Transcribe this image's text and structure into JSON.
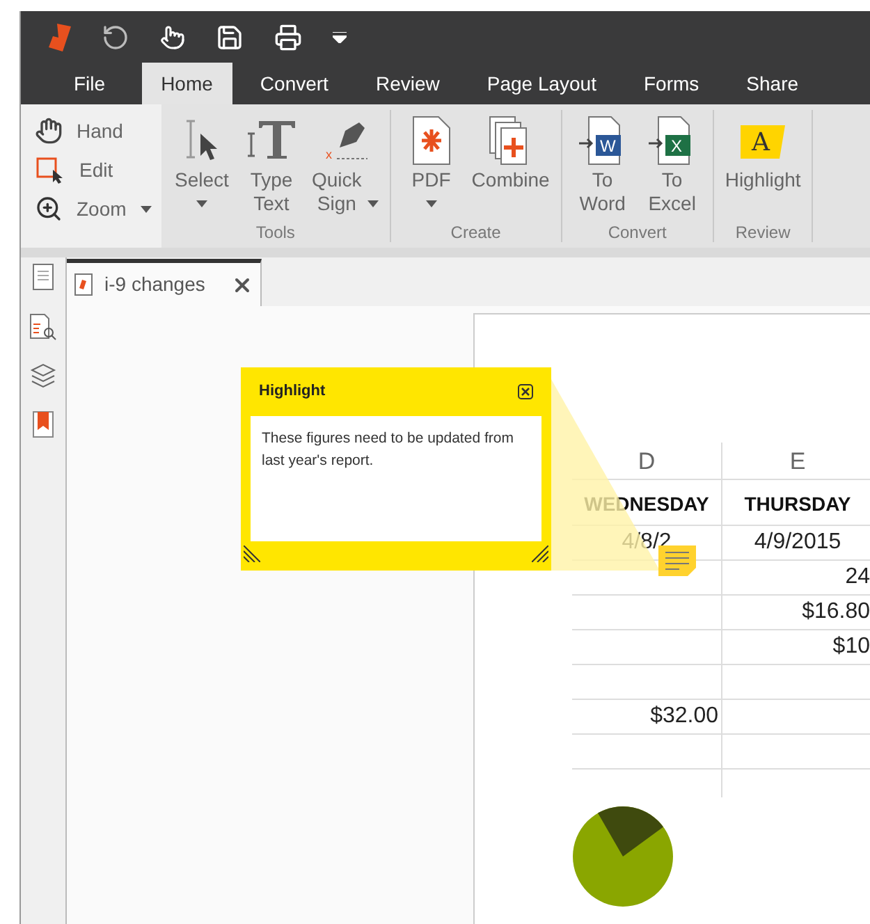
{
  "menu_tabs": [
    {
      "label": "File",
      "selected": false
    },
    {
      "label": "Home",
      "selected": true
    },
    {
      "label": "Convert",
      "selected": false
    },
    {
      "label": "Review",
      "selected": false
    },
    {
      "label": "Page Layout",
      "selected": false
    },
    {
      "label": "Forms",
      "selected": false
    },
    {
      "label": "Share",
      "selected": false
    }
  ],
  "nav_tools": [
    {
      "label": "Hand",
      "dropdown": false
    },
    {
      "label": "Edit",
      "dropdown": false
    },
    {
      "label": "Zoom",
      "dropdown": true
    }
  ],
  "ribbon_groups": [
    {
      "label": "Tools",
      "buttons": [
        {
          "label": "Select",
          "dropdown": true,
          "kind": "stacked"
        },
        {
          "label": "Type Text",
          "dropdown": false,
          "kind": "stacked"
        },
        {
          "label": "Quick Sign",
          "dropdown": true,
          "kind": "inline",
          "icon_text": "x"
        }
      ]
    },
    {
      "label": "Create",
      "buttons": [
        {
          "label": "PDF",
          "dropdown": true,
          "kind": "stacked"
        },
        {
          "label": "Combine",
          "dropdown": false,
          "kind": "stacked"
        }
      ]
    },
    {
      "label": "Convert",
      "buttons": [
        {
          "label": "To Word",
          "dropdown": false,
          "kind": "stacked",
          "icon_text": "W"
        },
        {
          "label": "To Excel",
          "dropdown": false,
          "kind": "stacked",
          "icon_text": "X"
        }
      ]
    },
    {
      "label": "Review",
      "buttons": [
        {
          "label": "Highlight",
          "dropdown": false,
          "kind": "stacked",
          "icon_text": "A"
        }
      ]
    }
  ],
  "document_tab": {
    "title": "i-9 changes"
  },
  "note": {
    "title": "Highlight",
    "text": "These figures need to be updated from last year's report."
  },
  "sheet": {
    "columns": [
      "D",
      "E"
    ],
    "rows": [
      {
        "kind": "header",
        "cells": [
          "WEDNESDAY",
          "THURSDAY"
        ]
      },
      {
        "kind": "date",
        "cells": [
          "4/8/2",
          "4/9/2015"
        ]
      },
      {
        "kind": "amount",
        "cells": [
          null,
          "24"
        ]
      },
      {
        "kind": "amount",
        "cells": [
          null,
          "$16.80"
        ]
      },
      {
        "kind": "amount",
        "cells": [
          null,
          "$10"
        ]
      },
      {
        "kind": "amount",
        "cells": [
          null,
          null
        ]
      },
      {
        "kind": "amount",
        "cells": [
          "$32.00",
          null
        ]
      },
      {
        "kind": "amount",
        "cells": [
          null,
          null
        ]
      }
    ]
  }
}
